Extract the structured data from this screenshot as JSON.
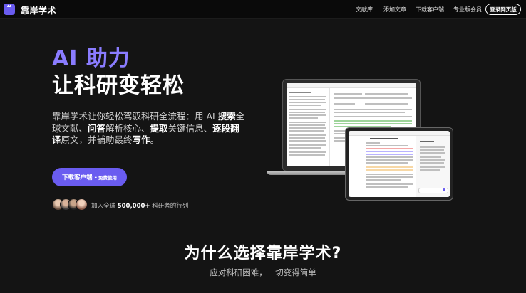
{
  "header": {
    "logo_glyph": "“",
    "brand": "靠岸学术",
    "nav": [
      {
        "label": "文献库"
      },
      {
        "label": "添加文章"
      },
      {
        "label": "下载客户端"
      },
      {
        "label": "专业版会员"
      }
    ],
    "login_label": "登录网页版"
  },
  "hero": {
    "title_line1": "AI 助力",
    "title_line2": "让科研变轻松",
    "desc": [
      {
        "t": "靠岸学术让你轻松驾驭科研全流程：用 AI ",
        "b": false
      },
      {
        "t": "搜索",
        "b": true
      },
      {
        "t": "全球文献、",
        "b": false
      },
      {
        "t": "问答",
        "b": true
      },
      {
        "t": "解析核心、",
        "b": false
      },
      {
        "t": "提取",
        "b": true
      },
      {
        "t": "关键信息、",
        "b": false
      },
      {
        "t": "逐段翻译",
        "b": true
      },
      {
        "t": "原文，并辅助最终",
        "b": false
      },
      {
        "t": "写作",
        "b": true
      },
      {
        "t": "。",
        "b": false
      }
    ],
    "download_label": "下载客户端 - ",
    "download_free": "免费使用",
    "join_prefix": "加入全球 ",
    "join_count": "500,000+",
    "join_suffix": " 科研者的行列"
  },
  "colors": {
    "accent": "#6a5cf0",
    "accent_light": "#8a7cff",
    "background": "#141414"
  },
  "section": {
    "title": "为什么选择靠岸学术?",
    "subtitle": "应对科研困难，一切变得简单"
  }
}
